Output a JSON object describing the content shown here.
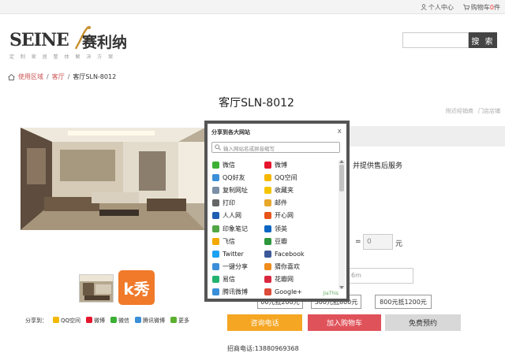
{
  "topbar": {
    "account_label": "个人中心",
    "cart_label": "购物车",
    "cart_count": "0",
    "cart_unit": "件"
  },
  "header": {
    "brand_en": "SEINE",
    "brand_cn": "赛利纳",
    "tagline": "定 制 家 居 整 体 解 决 方 案",
    "search_placeholder": "",
    "search_button": "搜 索"
  },
  "breadcrumb": {
    "items": [
      "使用区域",
      "客厅",
      "客厅SLN-8012"
    ],
    "separator": "/"
  },
  "product": {
    "title": "客厅SLN-8012",
    "side_links": [
      "附近经销商",
      "门店店铺"
    ],
    "service_text": "，并提供售后服务",
    "qty_equals": "=",
    "qty_value": "0",
    "qty_unit": "元",
    "paren_end": "）",
    "area_placeholder": "6m",
    "kxiu_label": "k秀"
  },
  "coupons": [
    "00元抵200元",
    "500元抵800元",
    "800元抵1200元"
  ],
  "buttons": {
    "consult": "咨询电话",
    "cart": "加入购物车",
    "book": "免费预约"
  },
  "hotline": "招商电话:13880969368",
  "share_row": {
    "label": "分享到：",
    "items": [
      {
        "label": "QQ空间",
        "color": "#f5b800"
      },
      {
        "label": "微博",
        "color": "#e6162d"
      },
      {
        "label": "微信",
        "color": "#3cb034"
      },
      {
        "label": "腾讯微博",
        "color": "#3a8fd8"
      },
      {
        "label": "更多",
        "color": "#5db02f"
      }
    ]
  },
  "popup": {
    "title": "分享到各大网站",
    "close": "x",
    "search_placeholder": "输入网站名或拼音缩写",
    "footer": "JiaThis",
    "items": [
      {
        "label": "微信",
        "color": "#3cb034"
      },
      {
        "label": "微博",
        "color": "#e6162d"
      },
      {
        "label": "QQ好友",
        "color": "#3a8fd8"
      },
      {
        "label": "QQ空间",
        "color": "#f5b800"
      },
      {
        "label": "复制网址",
        "color": "#7b8fa6"
      },
      {
        "label": "收藏夹",
        "color": "#f5c400"
      },
      {
        "label": "打印",
        "color": "#666666"
      },
      {
        "label": "邮件",
        "color": "#e8a82c"
      },
      {
        "label": "人人网",
        "color": "#1e5fb4"
      },
      {
        "label": "开心网",
        "color": "#e8551c"
      },
      {
        "label": "印象笔记",
        "color": "#52a745"
      },
      {
        "label": "领英",
        "color": "#0a66c2"
      },
      {
        "label": "飞信",
        "color": "#f2a900"
      },
      {
        "label": "豆瓣",
        "color": "#2e963d"
      },
      {
        "label": "Twitter",
        "color": "#1da1f2"
      },
      {
        "label": "Facebook",
        "color": "#3b5998"
      },
      {
        "label": "一键分享",
        "color": "#3a8fd8"
      },
      {
        "label": "猜你喜欢",
        "color": "#f08c1e"
      },
      {
        "label": "易信",
        "color": "#23b36f"
      },
      {
        "label": "花瓣网",
        "color": "#d8283e"
      },
      {
        "label": "腾讯微博",
        "color": "#3a8fd8"
      },
      {
        "label": "Google+",
        "color": "#dd4b39"
      }
    ]
  }
}
